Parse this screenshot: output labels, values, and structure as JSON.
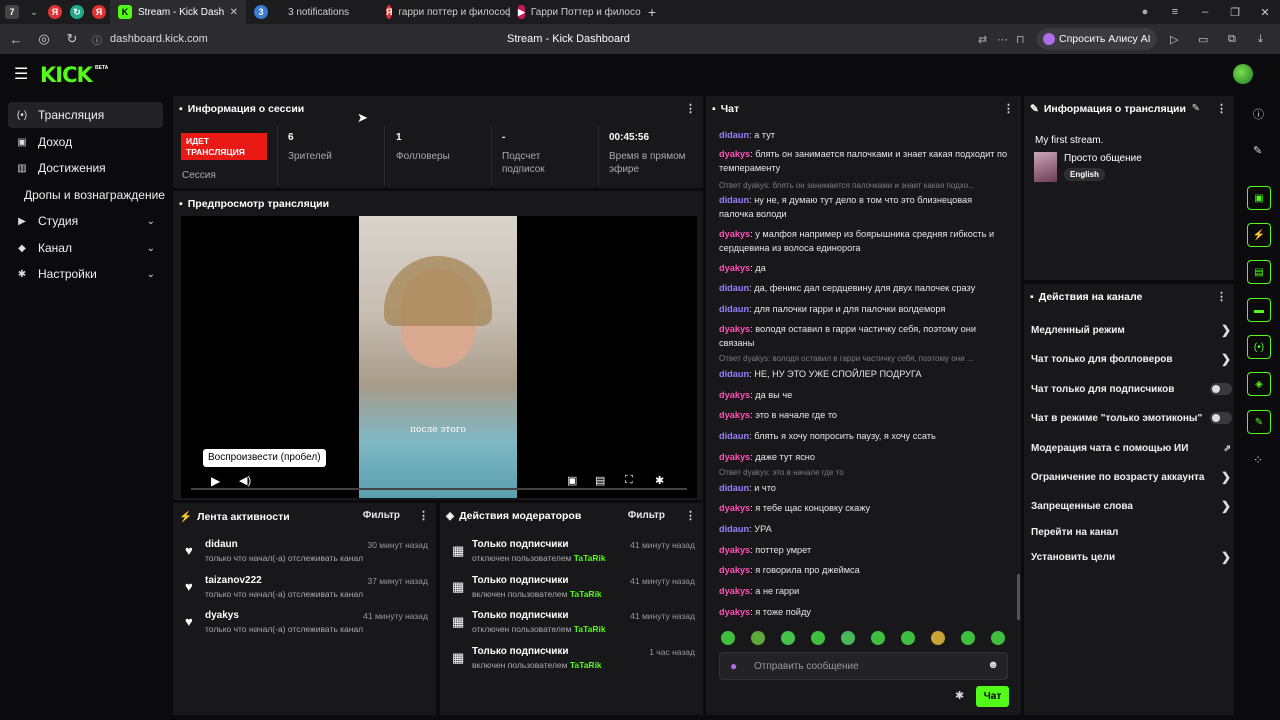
{
  "browser": {
    "tabs": [
      {
        "label": "Stream - Kick Dashboa"
      },
      {
        "label": "3 notifications"
      },
      {
        "label": "гарри поттер и философ"
      },
      {
        "label": "Гарри Поттер и филосо"
      }
    ],
    "url": "dashboard.kick.com",
    "page_title": "Stream - Kick Dashboard",
    "alice_button": "Спросить Алису AI"
  },
  "kick": {
    "logo": "KICK",
    "beta": "BETA"
  },
  "sidebar": {
    "items": [
      {
        "label": "Трансляция"
      },
      {
        "label": "Доход"
      },
      {
        "label": "Достижения"
      },
      {
        "label": "Дропы и вознаграждение"
      },
      {
        "label": "Студия"
      },
      {
        "label": "Канал"
      },
      {
        "label": "Настройки"
      }
    ]
  },
  "session": {
    "title": "Информация о сессии",
    "live_badge": "ИДЕТ ТРАНСЛЯЦИЯ",
    "session_label": "Сессия",
    "stats": [
      {
        "value": "6",
        "label": "Зрителей"
      },
      {
        "value": "1",
        "label": "Фолловеры"
      },
      {
        "value": "-",
        "label": "Подсчет подписок"
      },
      {
        "value": "00:45:56",
        "label": "Время в прямом эфире"
      }
    ]
  },
  "preview": {
    "title": "Предпросмотр трансляции",
    "caption": "после этого",
    "tooltip": "Воспроизвести (пробел)"
  },
  "activity": {
    "title": "Лента активности",
    "filter": "Фильтр",
    "items": [
      {
        "name": "didaun",
        "desc": "только что начал(-а) отслеживать канал",
        "time": "30 минут назад"
      },
      {
        "name": "taizanov222",
        "desc": "только что начал(-а) отслеживать канал",
        "time": "37 минут назад"
      },
      {
        "name": "dyakys",
        "desc": "только что начал(-а) отслеживать канал",
        "time": "41 минуту назад"
      }
    ]
  },
  "modactions": {
    "title": "Действия модераторов",
    "filter": "Фильтр",
    "items": [
      {
        "name": "Только подписчики",
        "desc": "отключен пользователем",
        "user": "TaTaRik",
        "time": "41 минуту назад"
      },
      {
        "name": "Только подписчики",
        "desc": "включен пользователем",
        "user": "TaTaRik",
        "time": "41 минуту назад"
      },
      {
        "name": "Только подписчики",
        "desc": "отключен пользователем",
        "user": "TaTaRik",
        "time": "41 минуту назад"
      },
      {
        "name": "Только подписчики",
        "desc": "включен пользователем",
        "user": "TaTaRik",
        "time": "1 час назад"
      }
    ]
  },
  "chat": {
    "title": "Чат",
    "messages": [
      {
        "user": "didaun",
        "text": ": а тут"
      },
      {
        "user": "dyakys",
        "text": ": блять он занимается палочками и знает какая подходит по темпераменту"
      },
      {
        "reply": "Ответ dyakys: блять он занимается палочками и знает какая подхо..."
      },
      {
        "user": "didaun",
        "text": ": ну не, я думаю тут дело в том что это близнецовая палочка володи"
      },
      {
        "user": "dyakys",
        "text": ": у малфоя например из боярышника средняя гибкость и сердцевина из волоса единорога"
      },
      {
        "user": "dyakys",
        "text": ": да"
      },
      {
        "user": "didaun",
        "text": ": да, феникс дал сердцевину для двух палочек сразу"
      },
      {
        "user": "didaun",
        "text": ": для палочки гарри и для палочки волдеморя"
      },
      {
        "user": "dyakys",
        "text": ": володя оставил в гарри частичку себя, поэтому они связаны"
      },
      {
        "reply": "Ответ dyakys: володя оставил в гарри частичку себя, поэтому они ..."
      },
      {
        "user": "didaun",
        "text": ": НЕ, НУ ЭТО УЖЕ СПОЙЛЕР ПОДРУГА"
      },
      {
        "user": "dyakys",
        "text": ": да вы че"
      },
      {
        "user": "dyakys",
        "text": ": это в начале где то"
      },
      {
        "user": "didaun",
        "text": ": блять я хочу попросить паузу, я хочу ссать"
      },
      {
        "user": "dyakys",
        "text": ": даже тут ясно"
      },
      {
        "reply": "Ответ dyakys: это в начале где то"
      },
      {
        "user": "didaun",
        "text": ": и что"
      },
      {
        "user": "dyakys",
        "text": ": я тебе щас концовку скажу"
      },
      {
        "user": "didaun",
        "text": ": УРА"
      },
      {
        "user": "dyakys",
        "text": ": поттер умрет"
      },
      {
        "user": "dyakys",
        "text": ": я говорила про джеймса"
      },
      {
        "user": "dyakys",
        "text": ": а не гарри"
      },
      {
        "user": "dyakys",
        "text": ": я тоже пойду"
      }
    ],
    "placeholder": "Отправить сообщение",
    "send": "Чат"
  },
  "stream_info": {
    "title": "Информация о трансляции",
    "stream_title": "My first stream.",
    "category": "Просто общение",
    "language": "English"
  },
  "channel_actions": {
    "title": "Действия на канале",
    "items": [
      {
        "label": "Медленный режим",
        "control": "arrow"
      },
      {
        "label": "Чат только для фолловеров",
        "control": "arrow"
      },
      {
        "label": "Чат только для подписчиков",
        "control": "toggle"
      },
      {
        "label": "Чат в режиме \"только эмотиконы\"",
        "control": "toggle"
      },
      {
        "label": "Модерация чата с помощью ИИ",
        "control": "external"
      },
      {
        "label": "Ограничение по возрасту аккаунта",
        "control": "arrow"
      },
      {
        "label": "Запрещенные слова",
        "control": "arrow"
      },
      {
        "label": "Перейти на канал",
        "control": "none"
      },
      {
        "label": "Установить цели",
        "control": "arrow"
      }
    ]
  },
  "colors": {
    "accent": "#53fc18",
    "live": "#e91916",
    "panel": "#18181b",
    "bg": "#0b0b0d"
  }
}
